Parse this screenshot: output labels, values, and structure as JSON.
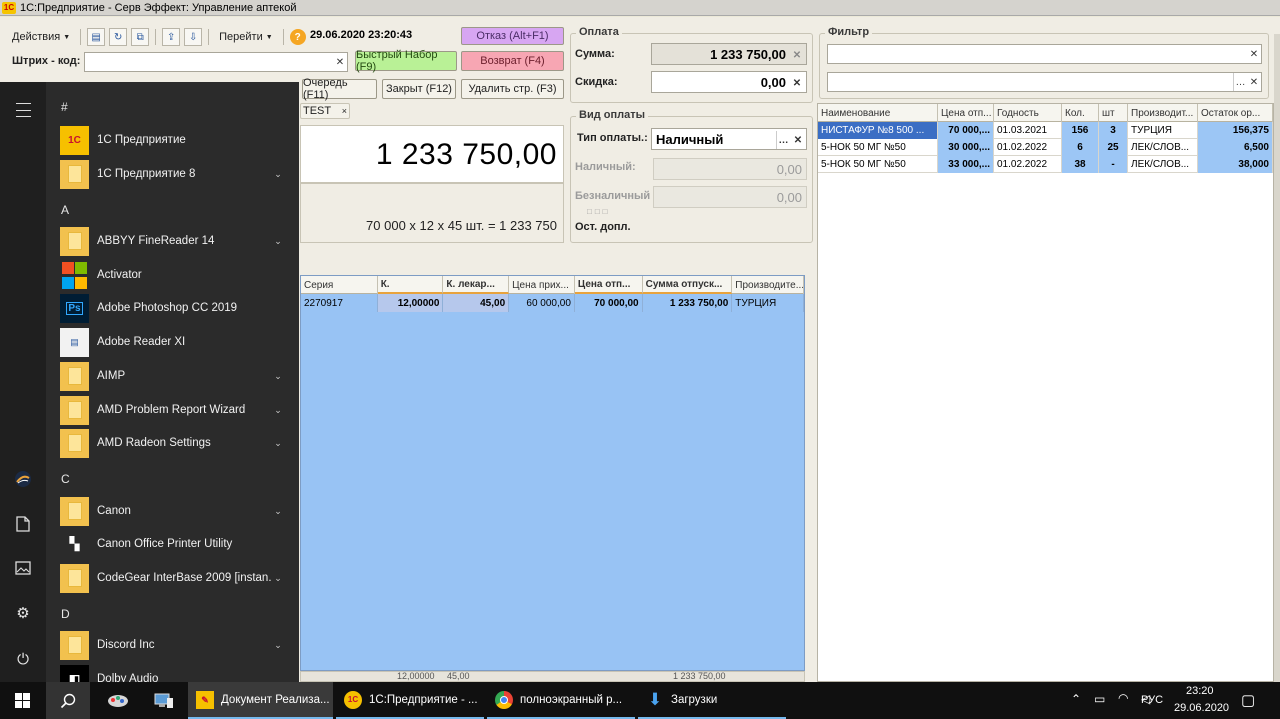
{
  "window": {
    "title": "1С:Предприятие - Серв Эффект: Управление аптекой",
    "logo": "1C"
  },
  "toolbar": {
    "actions_label": "Действия",
    "goto_label": "Перейти",
    "datetime": "29.06.2020 23:20:43",
    "icons": [
      "document-icon",
      "refresh-icon",
      "copy-icon",
      "export-icon",
      "import-icon",
      "help-icon"
    ]
  },
  "buttons": {
    "cancel": "Отказ (Alt+F1)",
    "quick_set": "Быстрый Набор (F9)",
    "return": "Возврат (F4)",
    "queue": "Очередь (F11)",
    "close": "Закрыт (F12)",
    "delete_row": "Удалить стр. (F3)",
    "tab_partial": "TEST"
  },
  "barcode": {
    "label": "Штрих - код:",
    "value": ""
  },
  "totals": {
    "big_total": "1 233 750,00",
    "calc_line": "70 000 x 12  x 45 шт.  = 1 233 750"
  },
  "payment": {
    "group_title": "Оплата",
    "sum_label": "Сумма:",
    "sum_value": "1 233 750,00",
    "discount_label": "Скидка:",
    "discount_value": "0,00",
    "type_group_title": "Вид оплаты",
    "type_label": "Тип оплаты.:",
    "type_value": "Наличный",
    "cash_label": "Наличный:",
    "cash_value": "0,00",
    "noncash_label": "Безналичный",
    "noncash_value": "0,00",
    "remaining_label": "Ост. допл."
  },
  "filter": {
    "group_title": "Фильтр",
    "value1": "",
    "value2": ""
  },
  "center_grid": {
    "columns": [
      "Серия",
      "К.",
      "К. лекар...",
      "Цена прих...",
      "Цена отп...",
      "Сумма отпуск...",
      "Производите..."
    ],
    "rows": [
      [
        "2270917",
        "12,00000",
        "45,00",
        "60 000,00",
        "70 000,00",
        "1 233 750,00",
        "ТУРЦИЯ"
      ]
    ],
    "footer": [
      "12,00000",
      "45,00",
      "1 233 750,00"
    ]
  },
  "right_table": {
    "columns": [
      "Наименование",
      "Цена отп...",
      "Годность",
      "Кол.",
      "шт",
      "Производит...",
      "Остаток ор..."
    ],
    "rows": [
      [
        "НИСТАФУР №8 500 ...",
        "70 000,...",
        "01.03.2021",
        "156",
        "3",
        "ТУРЦИЯ",
        "156,375"
      ],
      [
        "5-НОК 50 МГ №50",
        "30 000,...",
        "01.02.2022",
        "6",
        "25",
        "ЛЕК/СЛОВ...",
        "6,500"
      ],
      [
        "5-НОК 50 МГ №50",
        "33 000,...",
        "01.02.2022",
        "38",
        "-",
        "ЛЕК/СЛОВ...",
        "38,000"
      ]
    ]
  },
  "start_menu": {
    "sections": [
      {
        "letter": "#",
        "items": [
          {
            "name": "1С Предприятие",
            "icon": "onec-icon",
            "expand": false
          },
          {
            "name": "1С Предприятие 8",
            "icon": "folder-icon",
            "expand": true
          }
        ]
      },
      {
        "letter": "A",
        "items": [
          {
            "name": "ABBYY FineReader 14",
            "icon": "folder-icon",
            "expand": true
          },
          {
            "name": "Activator",
            "icon": "windows-tiles-icon",
            "expand": false
          },
          {
            "name": "Adobe Photoshop CC 2019",
            "icon": "photoshop-icon",
            "expand": false
          },
          {
            "name": "Adobe Reader XI",
            "icon": "pdf-icon",
            "expand": false
          },
          {
            "name": "AIMP",
            "icon": "folder-icon",
            "expand": true
          },
          {
            "name": "AMD Problem Report Wizard",
            "icon": "folder-icon",
            "expand": true
          },
          {
            "name": "AMD Radeon Settings",
            "icon": "folder-icon",
            "expand": true
          }
        ]
      },
      {
        "letter": "C",
        "items": [
          {
            "name": "Canon",
            "icon": "folder-icon",
            "expand": true
          },
          {
            "name": "Canon Office Printer Utility",
            "icon": "tiles-icon",
            "expand": false
          },
          {
            "name": "CodeGear InterBase 2009 [instan...",
            "icon": "folder-icon",
            "expand": true
          }
        ]
      },
      {
        "letter": "D",
        "items": [
          {
            "name": "Discord Inc",
            "icon": "folder-icon",
            "expand": true
          },
          {
            "name": "Dolby Audio",
            "icon": "dolby-icon",
            "expand": false
          }
        ]
      }
    ],
    "rail_icons": [
      "menu-icon",
      "user-avatar-icon",
      "document-icon",
      "pictures-icon",
      "settings-icon",
      "power-icon"
    ]
  },
  "taskbar": {
    "tasks": [
      {
        "label": "Документ Реализа...",
        "icon": "onec-doc-icon",
        "active": true
      },
      {
        "label": "1С:Предприятие - ...",
        "icon": "onec-icon",
        "active": false
      },
      {
        "label": "полноэкранный р...",
        "icon": "chrome-icon",
        "active": false
      },
      {
        "label": "Загрузки",
        "icon": "download-icon",
        "active": false
      }
    ],
    "lang": "РУС",
    "time": "23:20",
    "date": "29.06.2020"
  },
  "colors": {
    "grid_blue": "#98c3f4",
    "selected_row": "#3b6ec4",
    "cancel_button": "#d7a6f2",
    "quick_button": "#b9f196",
    "return_button": "#f7a6b3",
    "start_bg": "#2b2b2b",
    "taskbar_bg": "#101010"
  }
}
